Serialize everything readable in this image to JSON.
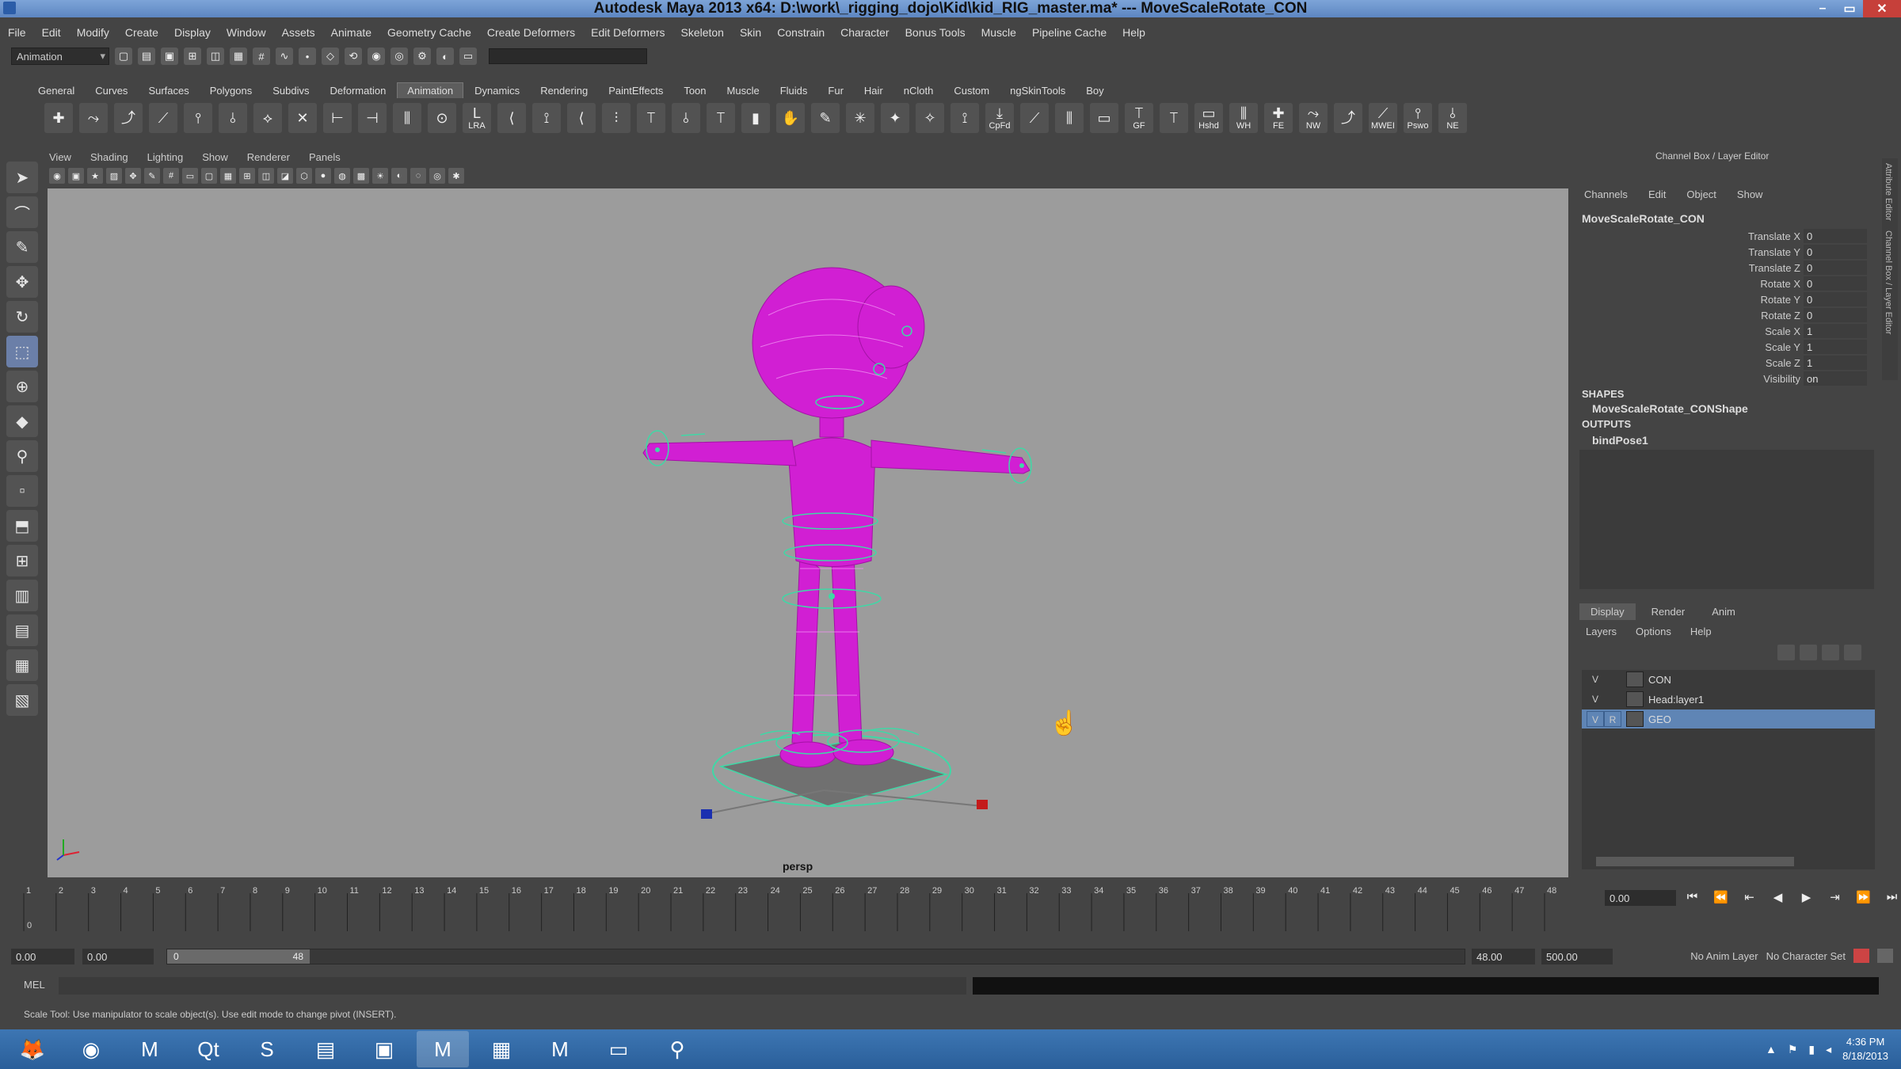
{
  "window": {
    "title": "Autodesk Maya 2013 x64: D:\\work\\_rigging_dojo\\Kid\\kid_RIG_master.ma*   ---   MoveScaleRotate_CON",
    "controls": [
      "–",
      "▭",
      "✕"
    ]
  },
  "menubar": [
    "File",
    "Edit",
    "Modify",
    "Create",
    "Display",
    "Window",
    "Assets",
    "Animate",
    "Geometry Cache",
    "Create Deformers",
    "Edit Deformers",
    "Skeleton",
    "Skin",
    "Constrain",
    "Character",
    "Bonus Tools",
    "Muscle",
    "Pipeline Cache",
    "Help"
  ],
  "statusline": {
    "mode": "Animation"
  },
  "shelf": {
    "tabs": [
      "General",
      "Curves",
      "Surfaces",
      "Polygons",
      "Subdivs",
      "Deformation",
      "Animation",
      "Dynamics",
      "Rendering",
      "PaintEffects",
      "Toon",
      "Muscle",
      "Fluids",
      "Fur",
      "Hair",
      "nCloth",
      "Custom",
      "ngSkinTools",
      "Boy"
    ],
    "active_tab": "Animation",
    "labeled_buttons": [
      "LRA",
      "CpFd",
      "GF",
      "Hshd",
      "WH",
      "FE",
      "NW",
      "MWEI",
      "Pswo",
      "NE"
    ]
  },
  "viewport": {
    "menu": [
      "View",
      "Shading",
      "Lighting",
      "Show",
      "Renderer",
      "Panels"
    ],
    "camera": "persp",
    "background": "#9c9c9c",
    "mesh_color": "#d11fd3",
    "control_color": "#3fd8a6"
  },
  "channel_box": {
    "title": "Channel Box / Layer Editor",
    "menu": [
      "Channels",
      "Edit",
      "Object",
      "Show"
    ],
    "object": "MoveScaleRotate_CON",
    "channels": [
      {
        "name": "Translate X",
        "value": "0"
      },
      {
        "name": "Translate Y",
        "value": "0"
      },
      {
        "name": "Translate Z",
        "value": "0"
      },
      {
        "name": "Rotate X",
        "value": "0"
      },
      {
        "name": "Rotate Y",
        "value": "0"
      },
      {
        "name": "Rotate Z",
        "value": "0"
      },
      {
        "name": "Scale X",
        "value": "1"
      },
      {
        "name": "Scale Y",
        "value": "1"
      },
      {
        "name": "Scale Z",
        "value": "1"
      },
      {
        "name": "Visibility",
        "value": "on"
      }
    ],
    "shapes_header": "SHAPES",
    "shape": "MoveScaleRotate_CONShape",
    "outputs_header": "OUTPUTS",
    "output": "bindPose1",
    "side_tabs": [
      "Attribute Editor",
      "Channel Box / Layer Editor"
    ]
  },
  "layer_editor": {
    "tabs": [
      "Display",
      "Render",
      "Anim"
    ],
    "active_tab": "Display",
    "menu": [
      "Layers",
      "Options",
      "Help"
    ],
    "layers": [
      {
        "v": "V",
        "r": "",
        "name": "CON",
        "selected": false
      },
      {
        "v": "V",
        "r": "",
        "name": "Head:layer1",
        "selected": false
      },
      {
        "v": "V",
        "r": "R",
        "name": "GEO",
        "selected": true
      }
    ]
  },
  "timeline": {
    "start": 1,
    "end": 48,
    "current_frame": "0.00",
    "playhead_label": "0",
    "transport": [
      "⏮",
      "⏪",
      "⇤",
      "◀",
      "▶",
      "⇥",
      "⏩",
      "⏭"
    ]
  },
  "range": {
    "anim_start": "0.00",
    "play_start": "0.00",
    "handle_start": "0",
    "handle_end": "48",
    "play_end": "48.00",
    "anim_end": "500.00",
    "anim_layer": "No Anim Layer",
    "character_set": "No Character Set"
  },
  "command_line": {
    "label": "MEL"
  },
  "help_line": "Scale Tool: Use manipulator to scale object(s). Use edit mode to change pivot (INSERT).",
  "taskbar": {
    "apps": [
      "firefox-icon",
      "chrome-icon",
      "maya-icon",
      "qt-icon",
      "skype-icon",
      "notepad-icon",
      "save-icon",
      "maya-2-icon",
      "excel-icon",
      "maya-3-icon",
      "folder-icon",
      "flashlight-icon"
    ],
    "time": "4:36 PM",
    "date": "8/18/2013"
  }
}
